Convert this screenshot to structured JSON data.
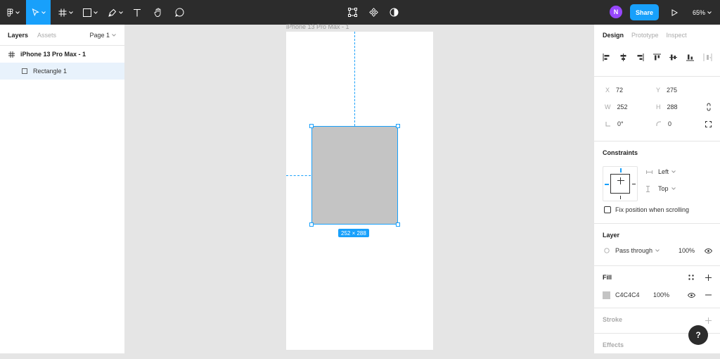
{
  "toolbar": {
    "share_label": "Share",
    "avatar_initial": "N",
    "zoom_label": "65%",
    "accent": "#18a0fb"
  },
  "left_panel": {
    "tabs": [
      {
        "label": "Layers",
        "active": true
      },
      {
        "label": "Assets",
        "active": false
      }
    ],
    "page_selector": "Page 1",
    "layers": [
      {
        "label": "iPhone 13 Pro Max - 1",
        "type": "frame"
      },
      {
        "label": "Rectangle 1",
        "type": "rectangle",
        "selected": true
      }
    ]
  },
  "canvas": {
    "frame_label": "iPhone 13 Pro Max - 1",
    "size_badge": "252 × 288",
    "shape_fill": "#c4c4c4"
  },
  "right_panel": {
    "tabs": [
      {
        "label": "Design",
        "active": true
      },
      {
        "label": "Prototype",
        "active": false
      },
      {
        "label": "Inspect",
        "active": false
      }
    ],
    "props": {
      "x_label": "X",
      "x": "72",
      "y_label": "Y",
      "y": "275",
      "w_label": "W",
      "w": "252",
      "h_label": "H",
      "h": "288",
      "rotation": "0°",
      "radius": "0"
    },
    "constraints": {
      "title": "Constraints",
      "horizontal": "Left",
      "vertical": "Top",
      "fix_position_label": "Fix position when scrolling"
    },
    "layer": {
      "title": "Layer",
      "blend": "Pass through",
      "opacity": "100%"
    },
    "fill": {
      "title": "Fill",
      "hex": "C4C4C4",
      "opacity": "100%"
    },
    "stroke": {
      "title": "Stroke"
    },
    "effects": {
      "title": "Effects"
    }
  },
  "help_label": "?"
}
